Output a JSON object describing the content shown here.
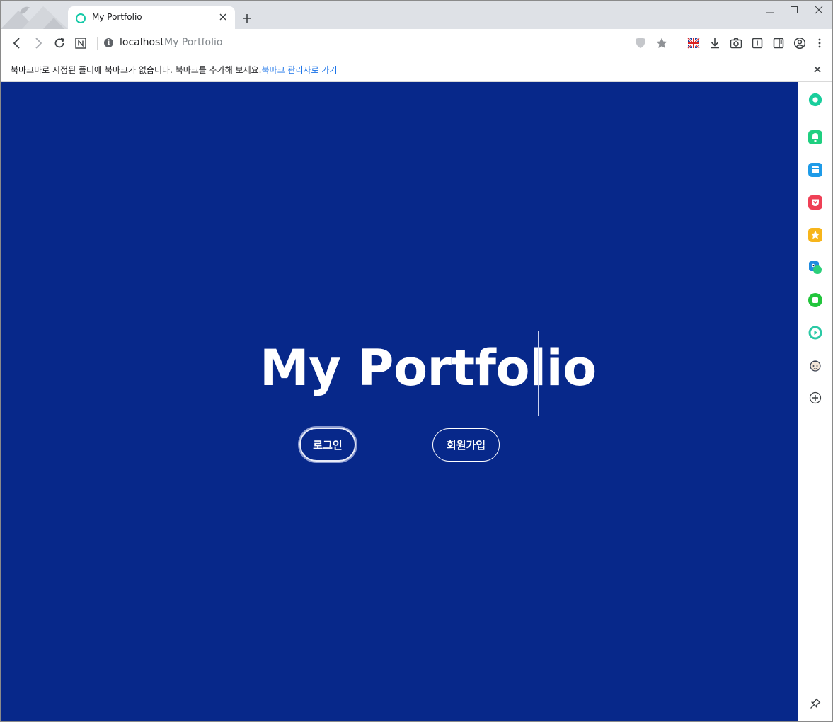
{
  "tab": {
    "title": "My Portfolio"
  },
  "address": {
    "host": "localhost",
    "page_title": "My Portfolio"
  },
  "bookmark_bar": {
    "message": "북마크바로 지정된 폴더에 북마크가 없습니다. 북마크를 추가해 보세요.",
    "link": "북마크 관리자로 가기"
  },
  "hero": {
    "title": "My Portfolio",
    "login_label": "로그인",
    "signup_label": "회원가입"
  },
  "colors": {
    "background": "#07288a",
    "tab_favicon": "#14c9a7"
  },
  "sidebar": {
    "items": [
      {
        "icon": "whale-home-icon",
        "color": "#19ce9c"
      },
      {
        "icon": "notification-bell-icon",
        "color": "#1fcf80"
      },
      {
        "icon": "calendar-icon",
        "color": "#1e9be8"
      },
      {
        "icon": "pocket-icon",
        "color": "#ef4056"
      },
      {
        "icon": "star-favorites-icon",
        "color": "#f7b51b"
      },
      {
        "icon": "papago-translate-icon",
        "color": "#1f8be0"
      },
      {
        "icon": "naver-square-icon",
        "color": "#22c53c"
      },
      {
        "icon": "play-media-icon",
        "color": "#2ac9a5"
      },
      {
        "icon": "character-avatar-icon",
        "color": "#3a4150"
      }
    ]
  }
}
